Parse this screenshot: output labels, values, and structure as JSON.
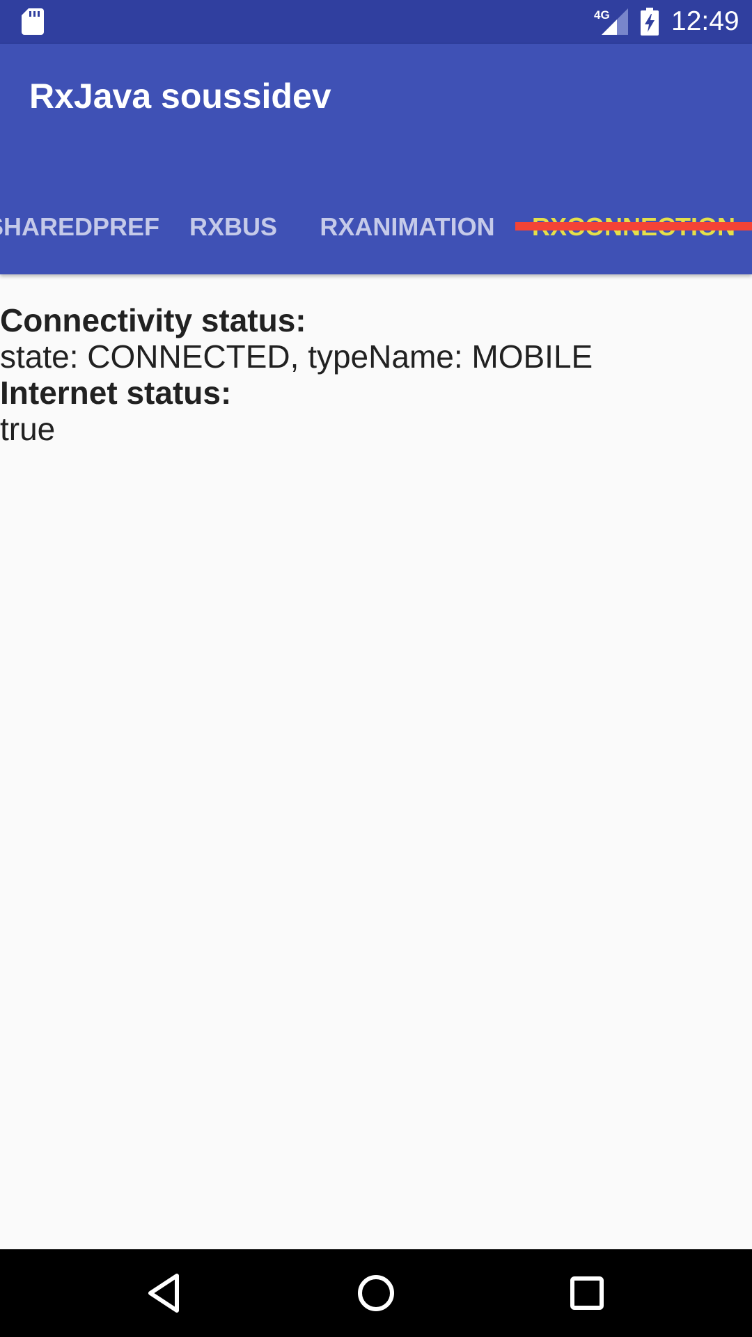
{
  "status_bar": {
    "network_type": "4G",
    "time": "12:49",
    "icons": [
      "sd-card-icon",
      "signal-icon",
      "battery-charging-icon"
    ]
  },
  "app_bar": {
    "title": "RxJava soussidev"
  },
  "tabs": [
    {
      "label": "SHAREDPREF",
      "active": false
    },
    {
      "label": "RXBUS",
      "active": false
    },
    {
      "label": "RXANIMATION",
      "active": false
    },
    {
      "label": "RXCONNECTION",
      "active": true
    }
  ],
  "content": {
    "connectivity_label": "Connectivity status:",
    "connectivity_value": "state: CONNECTED, typeName: MOBILE",
    "internet_label": "Internet status:",
    "internet_value": "true"
  },
  "nav_bar": {
    "buttons": [
      "back-icon",
      "home-icon",
      "recents-icon"
    ]
  },
  "colors": {
    "status_bar": "#303f9f",
    "primary": "#3f51b5",
    "tab_active_text": "#e4e04a",
    "tab_indicator": "#f44336",
    "background": "#fafafa"
  }
}
